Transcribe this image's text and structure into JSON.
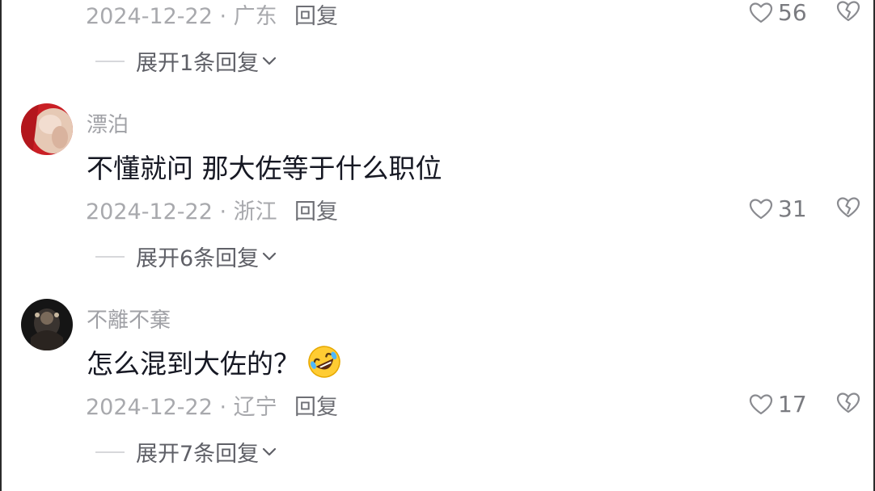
{
  "comments": [
    {
      "date": "2024-12-22",
      "region": "广东",
      "reply_label": "回复",
      "likes": "56",
      "expand_label": "展开1条回复"
    },
    {
      "username": "漂泊",
      "content": "不懂就问  那大佐等于什么职位",
      "date": "2024-12-22",
      "region": "浙江",
      "reply_label": "回复",
      "likes": "31",
      "expand_label": "展开6条回复"
    },
    {
      "username": "不離不棄",
      "content": "怎么混到大佐的？",
      "emoji": "rolling-on-floor-laughing-emoji",
      "date": "2024-12-22",
      "region": "辽宁",
      "reply_label": "回复",
      "likes": "17",
      "expand_label": "展开7条回复"
    }
  ],
  "meta_separator": " · ",
  "icons": {
    "like": "heart-outline-icon",
    "dislike": "broken-heart-outline-icon",
    "expand": "chevron-down-icon"
  },
  "colors": {
    "primary_text": "#161823",
    "secondary_text": "#a8a9ad",
    "link_text": "#5f6067"
  }
}
